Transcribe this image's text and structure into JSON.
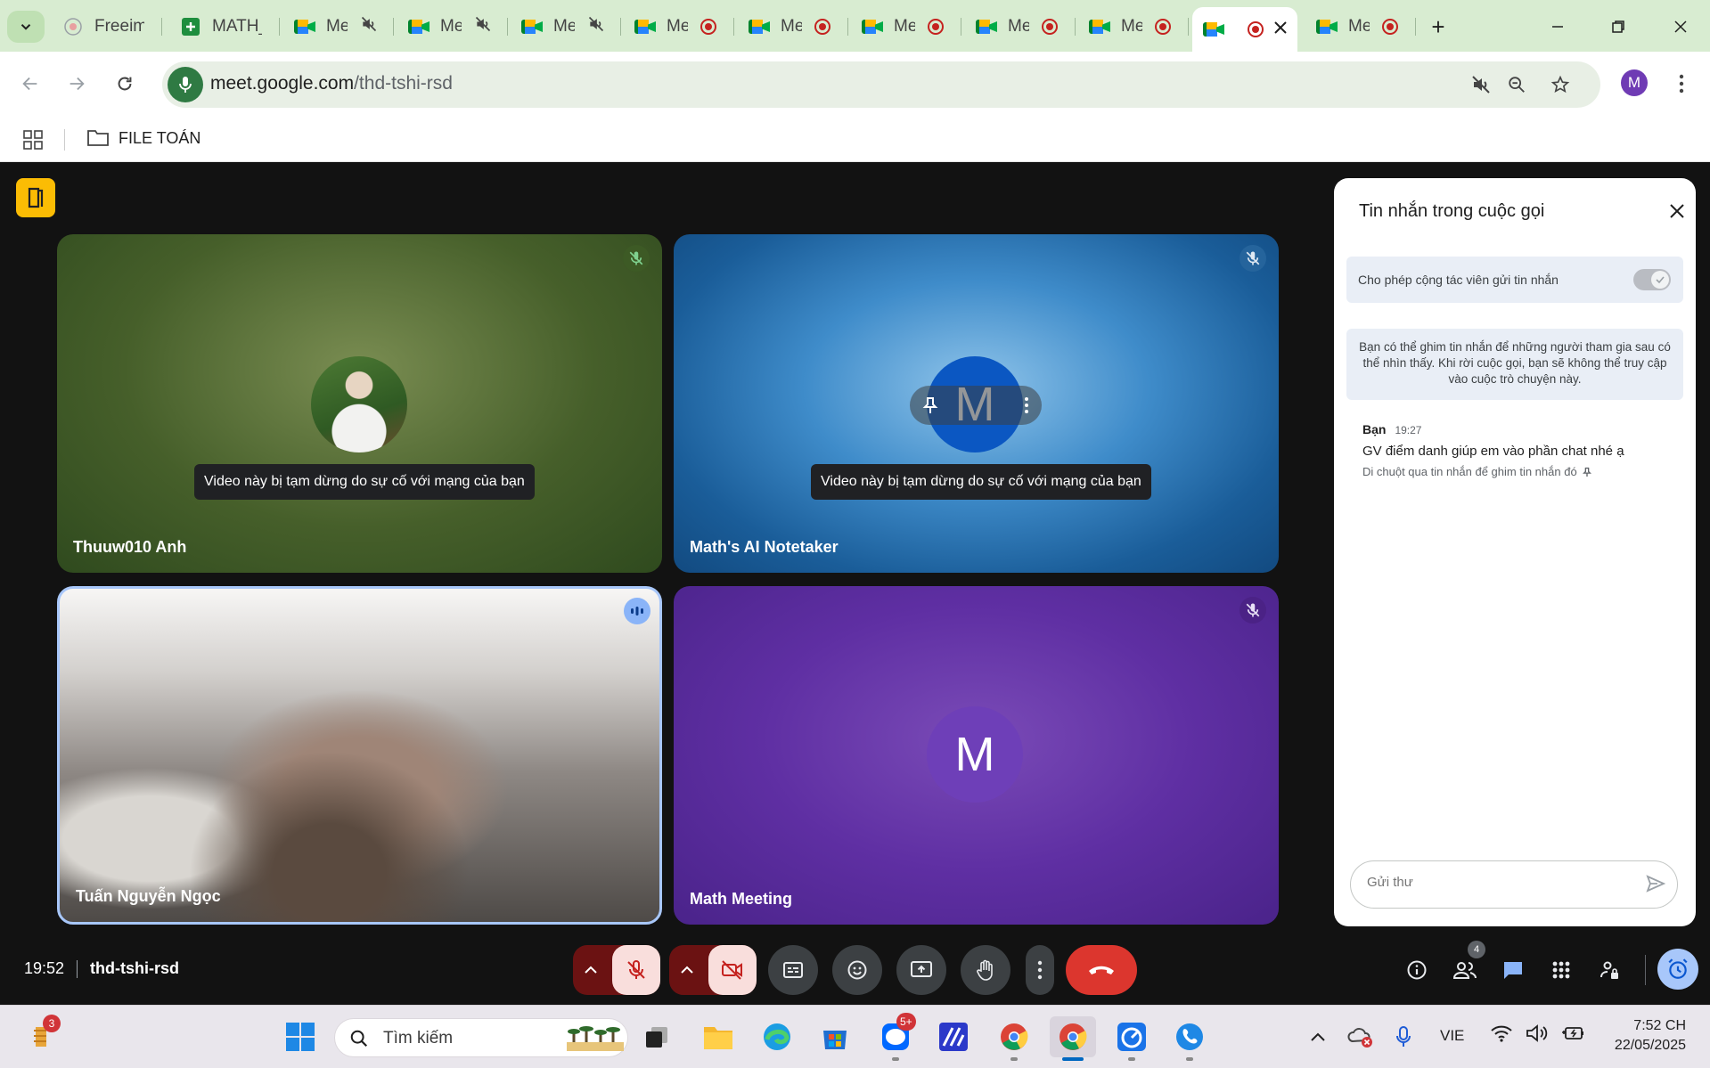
{
  "browser": {
    "tabs": [
      {
        "title": "Freeima",
        "icon": "freeimage-icon"
      },
      {
        "title": "MATH_",
        "icon": "sheets-icon"
      },
      {
        "title": "Me",
        "icon": "meet-icon",
        "indicator": "muted"
      },
      {
        "title": "Me",
        "icon": "meet-icon",
        "indicator": "muted"
      },
      {
        "title": "Me",
        "icon": "meet-icon",
        "indicator": "muted"
      },
      {
        "title": "Me",
        "icon": "meet-icon",
        "indicator": "recording"
      },
      {
        "title": "Me",
        "icon": "meet-icon",
        "indicator": "recording"
      },
      {
        "title": "Me",
        "icon": "meet-icon",
        "indicator": "recording"
      },
      {
        "title": "Me",
        "icon": "meet-icon",
        "indicator": "recording"
      },
      {
        "title": "Me",
        "icon": "meet-icon",
        "indicator": "recording"
      },
      {
        "title": "",
        "icon": "meet-icon",
        "indicator": "recording",
        "active": true
      },
      {
        "title": "Me",
        "icon": "meet-icon",
        "indicator": "recording"
      }
    ],
    "url_host": "meet.google.com",
    "url_path": "/thd-tshi-rsd",
    "profile_initial": "M",
    "bookmark_folder": "FILE TOÁN",
    "accent": "#d8ecd1"
  },
  "tiles": [
    {
      "name": "Thuuw010 Anh",
      "status": "Video này bị tạm dừng do sự cố với mạng của bạn"
    },
    {
      "name": "Math's AI Notetaker",
      "status": "Video này bị tạm dừng do sự cố với mạng của bạn",
      "initial": "M"
    },
    {
      "name": "Tuấn Nguyễn Ngọc"
    },
    {
      "name": "Math Meeting",
      "initial": "M"
    }
  ],
  "chat": {
    "title": "Tin nhắn trong cuộc gọi",
    "toggle_label": "Cho phép cộng tác viên gửi tin nhắn",
    "info": "Bạn có thể ghim tin nhắn để những người tham gia sau có thể nhìn thấy. Khi rời cuộc gọi, bạn sẽ không thể truy cập vào cuộc trò chuyện này.",
    "message": {
      "sender": "Bạn",
      "time": "19:27",
      "text": "GV điểm danh giúp em vào phần chat nhé ạ",
      "hint": "Di chuột qua tin nhắn để ghim tin nhắn đó"
    },
    "input_placeholder": "Gửi thư"
  },
  "meeting_bar": {
    "time": "19:52",
    "code": "thd-tshi-rsd",
    "people_count": "4"
  },
  "taskbar": {
    "widget_badge": "3",
    "search_placeholder": "Tìm kiếm",
    "zalo_badge": "5+",
    "language": "VIE",
    "clock_time": "7:52 CH",
    "clock_date": "22/05/2025"
  }
}
